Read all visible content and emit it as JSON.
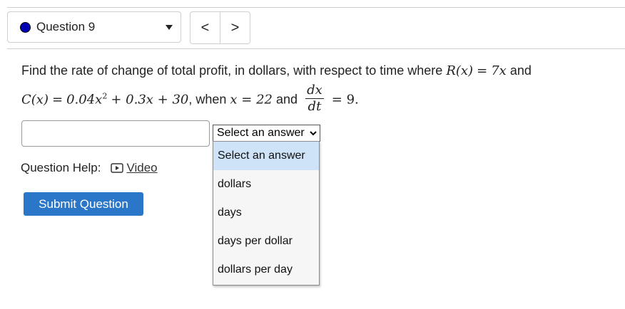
{
  "question_nav": {
    "label": "Question 9",
    "prev_symbol": "<",
    "next_symbol": ">"
  },
  "problem": {
    "line1_text": "Find the rate of change of total profit, in dollars, with respect to time where",
    "revenue_lhs": "R(x)",
    "revenue_eq": "=",
    "revenue_rhs": "7x",
    "and1": "and",
    "cost_lhs": "C(x)",
    "cost_eq": "=",
    "cost_rhs_a": "0.04x",
    "cost_exp": "2",
    "cost_rhs_b": "+ 0.3x + 30",
    "comma_when": ", when",
    "x_eq": "x = 22",
    "and2": "and",
    "deriv_num": "dx",
    "deriv_den": "dt",
    "deriv_rhs": "= 9."
  },
  "answer": {
    "value": "",
    "unit_select": {
      "selected": "Select an answer",
      "options": [
        "Select an answer",
        "dollars",
        "days",
        "days per dollar",
        "dollars per day"
      ],
      "highlighted": "Select an answer"
    }
  },
  "help": {
    "label": "Question Help:",
    "video_label": "Video"
  },
  "submit_label": "Submit Question",
  "colors": {
    "status_dot": "#0000b3",
    "submit_bg": "#2a77c9",
    "highlight": "#cfe3f8"
  }
}
